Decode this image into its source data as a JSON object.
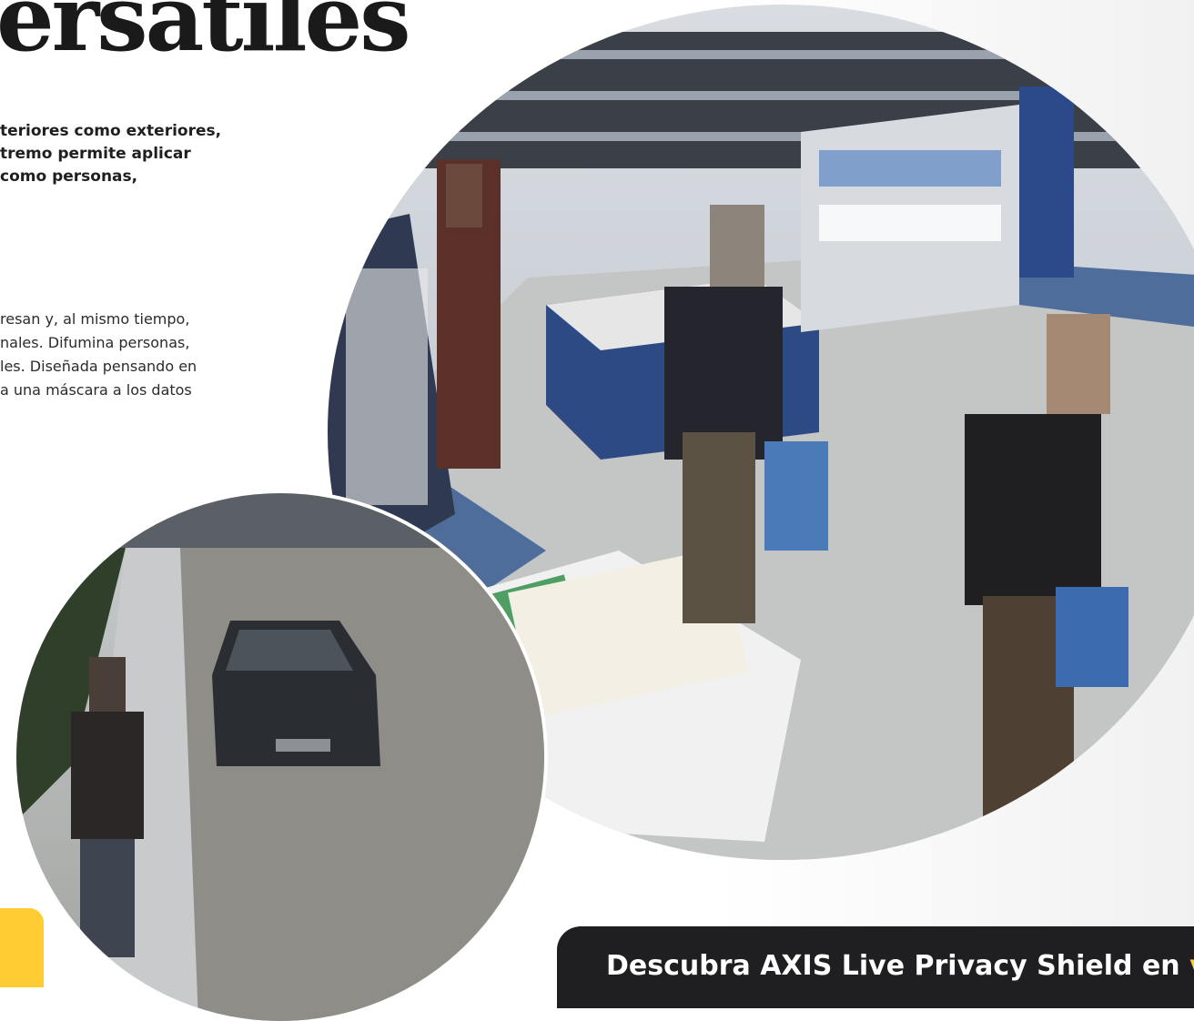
{
  "headline": "ersatiles",
  "intro_lines": [
    "teriores como exteriores,",
    "tremo permite aplicar",
    "como personas,"
  ],
  "body_lines": [
    "resan y, al mismo tiempo,",
    "nales. Difumina personas,",
    "les. Diseñada pensando en",
    "a una máscara a los datos"
  ],
  "banner": {
    "text": "Descubra AXIS Live Privacy Shield en",
    "accent": " ví"
  },
  "colors": {
    "accent_yellow": "#ffcc33",
    "banner_bg": "#1f1f21",
    "text_dark": "#1a1a1a"
  },
  "images": [
    "store-surveillance-photo",
    "street-surveillance-photo"
  ]
}
